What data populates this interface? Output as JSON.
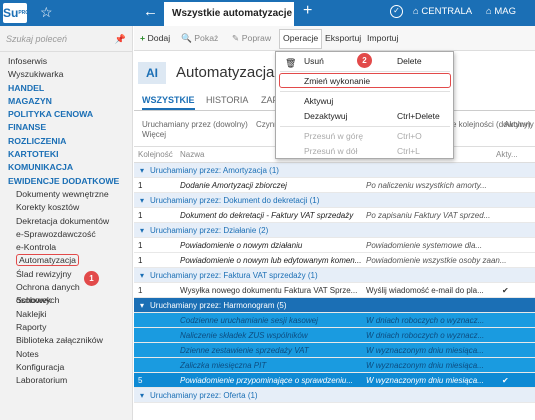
{
  "app": {
    "logo": "Su",
    "logo_sub": "PRO",
    "tab_title": "Wszystkie automatyzacje",
    "company": "CENTRALA",
    "warehouse": "MAG"
  },
  "sidebar": {
    "search_placeholder": "Szukaj poleceń",
    "items": [
      {
        "label": "Infoserwis",
        "type": "plain"
      },
      {
        "label": "Wyszukiwarka",
        "type": "plain"
      },
      {
        "label": "HANDEL",
        "type": "head"
      },
      {
        "label": "MAGAZYN",
        "type": "head"
      },
      {
        "label": "POLITYKA CENOWA",
        "type": "head"
      },
      {
        "label": "FINANSE",
        "type": "head"
      },
      {
        "label": "ROZLICZENIA",
        "type": "head"
      },
      {
        "label": "KARTOTEKI",
        "type": "head"
      },
      {
        "label": "KOMUNIKACJA",
        "type": "head"
      },
      {
        "label": "EWIDENCJE DODATKOWE",
        "type": "head"
      },
      {
        "label": "Dokumenty wewnętrzne",
        "type": "sub"
      },
      {
        "label": "Korekty kosztów",
        "type": "sub"
      },
      {
        "label": "Dekretacja dokumentów",
        "type": "sub"
      },
      {
        "label": "e-Sprawozdawczość",
        "type": "sub"
      },
      {
        "label": "e-Kontrola",
        "type": "sub"
      },
      {
        "label": "Automatyzacja",
        "type": "active"
      },
      {
        "label": "Ślad rewizyjny",
        "type": "sub"
      },
      {
        "label": "Ochrona danych osobowych",
        "type": "sub"
      },
      {
        "label": "Schowek",
        "type": "sub"
      },
      {
        "label": "Naklejki",
        "type": "sub"
      },
      {
        "label": "Raporty",
        "type": "sub"
      },
      {
        "label": "Biblioteka załączników",
        "type": "sub"
      },
      {
        "label": "Notes",
        "type": "sub"
      },
      {
        "label": "Konfiguracja",
        "type": "sub"
      },
      {
        "label": "Laboratorium",
        "type": "sub"
      }
    ]
  },
  "toolbar": {
    "add": "Dodaj",
    "show": "Pokaż",
    "edit": "Popraw",
    "operations": "Operacje",
    "export": "Eksportuj",
    "import": "Importuj"
  },
  "header": {
    "icon": "AI",
    "title": "Automatyzacja"
  },
  "tabs": [
    "WSZYSTKIE",
    "HISTORIA",
    "ZAP"
  ],
  "filters": {
    "f1": "Uruchamiany przez (dowolny)",
    "f2": "Czynn",
    "f3": "e kolejności (dowolny)",
    "f4": "Aktywny",
    "more": "Więcej"
  },
  "table": {
    "columns": {
      "order": "Kolejność",
      "name": "Nazwa",
      "active": "Akty..."
    },
    "rows": [
      {
        "kind": "group",
        "text": "Uruchamiany przez: Amortyzacja (1)"
      },
      {
        "kind": "data",
        "order": "1",
        "name": "Dodanie Amortyzacji zbiorczej",
        "desc": "Po naliczeniu wszystkich amorty...",
        "check": ""
      },
      {
        "kind": "group",
        "text": "Uruchamiany przez: Dokument do dekretacji (1)"
      },
      {
        "kind": "data",
        "order": "1",
        "name": "Dokument do dekretacji - Faktury VAT sprzedaży",
        "desc": "Po zapisaniu Faktury VAT sprzed...",
        "check": ""
      },
      {
        "kind": "group",
        "text": "Uruchamiany przez: Działanie (2)"
      },
      {
        "kind": "data",
        "order": "1",
        "name": "Powiadomienie o nowym działaniu",
        "desc": "Powiadomienie systemowe dla...",
        "check": ""
      },
      {
        "kind": "data",
        "order": "1",
        "name": "Powiadomienie o nowym lub edytowanym komen...",
        "desc": "Powiadomienie wszystkie osoby zaan...",
        "check": ""
      },
      {
        "kind": "group",
        "text": "Uruchamiany przez: Faktura VAT sprzedaży (1)"
      },
      {
        "kind": "data2",
        "order": "1",
        "name": "Wysyłka nowego dokumentu Faktura VAT Sprze...",
        "desc": "Wyślij wiadomość e-mail do pla...",
        "check": "✔"
      },
      {
        "kind": "groupsel",
        "text": "Uruchamiany przez: Harmonogram (5)"
      },
      {
        "kind": "sel",
        "order": "",
        "name": "Codzienne uruchamianie sesji kasowej",
        "desc": "W dniach roboczych o wyznacz...",
        "check": ""
      },
      {
        "kind": "sel",
        "order": "",
        "name": "Naliczenie składek ZUS wspólników",
        "desc": "W dniach roboczych o wyznacz...",
        "check": ""
      },
      {
        "kind": "sel",
        "order": "",
        "name": "Dzienne zestawienie sprzedaży VAT",
        "desc": "W wyznaczonym dniu miesiąca...",
        "check": ""
      },
      {
        "kind": "sel",
        "order": "",
        "name": "Zaliczka miesięczna PIT",
        "desc": "W wyznaczonym dniu miesiąca...",
        "check": ""
      },
      {
        "kind": "selcur",
        "order": "5",
        "name": "Powiadomienie przypominające o sprawdzeniu...",
        "desc": "W wyznaczonym dniu miesiąca...",
        "check": "✔"
      },
      {
        "kind": "group",
        "text": "Uruchamiany przez: Oferta (1)"
      }
    ]
  },
  "menu": {
    "delete": "Usuń",
    "delete_key": "Delete",
    "change": "Zmień wykonanie",
    "activate": "Aktywuj",
    "deactivate": "Dezaktywuj",
    "deactivate_key": "Ctrl+Delete",
    "move_up": "Przesuń w górę",
    "move_up_key": "Ctrl+O",
    "move_down": "Przesuń w dół",
    "move_down_key": "Ctrl+L"
  },
  "annotations": {
    "b1": "1",
    "b2": "2"
  }
}
